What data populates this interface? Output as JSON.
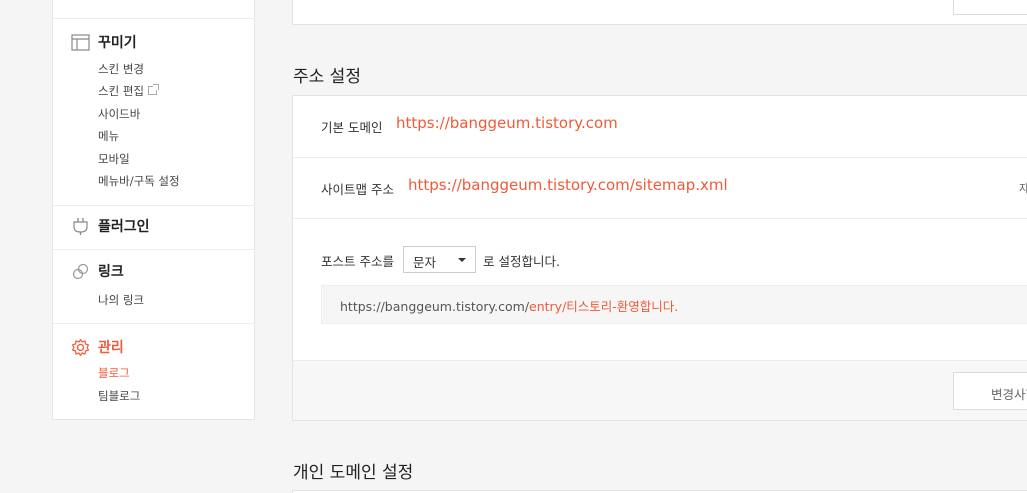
{
  "sidebar": {
    "groups": [
      {
        "title": "꾸미기",
        "icon": "layout-icon",
        "items": [
          "스킨 변경",
          "스킨 편집",
          "사이드바",
          "메뉴",
          "모바일",
          "메뉴바/구독 설정"
        ]
      },
      {
        "title": "플러그인",
        "icon": "plug-icon",
        "items": []
      },
      {
        "title": "링크",
        "icon": "link-icon",
        "items": [
          "나의 링크"
        ]
      },
      {
        "title": "관리",
        "icon": "gear-icon",
        "items": [
          "블로그",
          "팀블로그"
        ],
        "active": true,
        "active_item": "블로그"
      }
    ]
  },
  "address_section": {
    "title": "주소 설정",
    "default_domain_label": "기본 도메인",
    "default_domain_value": "https://banggeum.tistory.com",
    "sitemap_label": "사이트맵 주소",
    "sitemap_value": "https://banggeum.tistory.com/sitemap.xml",
    "sitemap_side_text": "자",
    "post_url_label": "포스트 주소를",
    "post_url_select_value": "문자",
    "post_url_suffix": "로 설정합니다.",
    "preview_base": "https://banggeum.tistory.com/",
    "preview_path": "entry/티스토리-환영합니다.",
    "save_button": "변경사항 저장"
  },
  "custom_domain_section": {
    "title": "개인 도메인 설정"
  },
  "colors": {
    "accent": "#f05a38"
  }
}
